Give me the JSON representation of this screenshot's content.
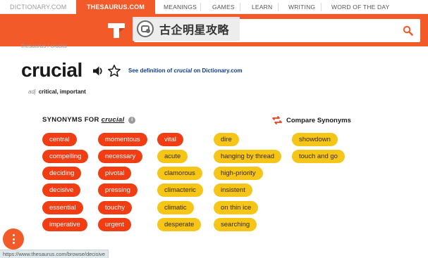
{
  "topnav": {
    "dictionary": "DICTIONARY.COM",
    "thesaurus": "THESAURUS.COM",
    "meanings": "MEANINGS",
    "games": "GAMES",
    "learn": "LEARN",
    "writing": "WRITING",
    "wotd": "WORD OF THE DAY"
  },
  "watermark": {
    "text": "古企明星攻略"
  },
  "breadcrumb": "thesaurus / crucial",
  "entry": {
    "word": "crucial",
    "def_prefix": "See definition of ",
    "def_word": "crucial",
    "def_suffix": " on Dictionary.com",
    "pos": "adj",
    "sense": "critical, important"
  },
  "synonyms": {
    "heading": "SYNONYMS FOR",
    "word": "crucial",
    "compare_label": "Compare Synonyms",
    "columns": [
      [
        "central",
        "compelling",
        "deciding",
        "decisive",
        "essential",
        "imperative"
      ],
      [
        "momentous",
        "necessary",
        "pivotal",
        "pressing",
        "touchy",
        "urgent"
      ],
      [
        "vital",
        "acute",
        "clamorous",
        "climacteric",
        "climatic",
        "desperate"
      ],
      [
        "dire",
        "hanging by thread",
        "high-priority",
        "insistent",
        "on thin ice",
        "searching"
      ],
      [
        "showdown",
        "touch and go"
      ]
    ]
  },
  "status_url": "https://www.thesaurus.com/browse/decisive",
  "colors": {
    "brand": "#f25a2a",
    "chip_strong": "#f03d14",
    "chip_medium": "#f5c518",
    "link": "#0d3d8c"
  }
}
